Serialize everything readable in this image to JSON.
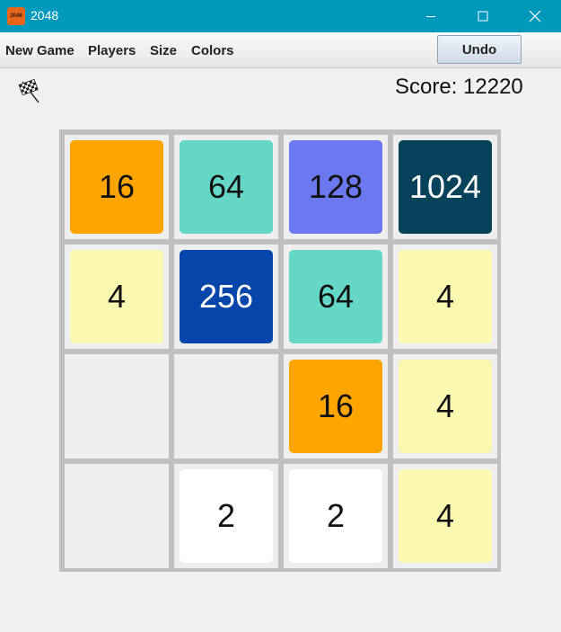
{
  "window": {
    "title": "2048",
    "icon_label": "2048",
    "controls": [
      "minimize-icon",
      "maximize-icon",
      "close-icon"
    ]
  },
  "menu": {
    "new_game": "New Game",
    "players": "Players",
    "size": "Size",
    "colors": "Colors",
    "undo": "Undo"
  },
  "status": {
    "icon": "checkered-flag-icon",
    "score_text": "Score: 12220",
    "score": 12220
  },
  "board": {
    "size": 4,
    "rows": [
      [
        "16",
        "64",
        "128",
        "1024"
      ],
      [
        "4",
        "256",
        "64",
        "4"
      ],
      [
        "",
        "",
        "16",
        "4"
      ],
      [
        "",
        "2",
        "2",
        "4"
      ]
    ]
  },
  "tile_colors": {
    "2": {
      "bg": "#ffffff",
      "fg": "#111111"
    },
    "4": {
      "bg": "#fbf8b2",
      "fg": "#111111"
    },
    "16": {
      "bg": "#ffa500",
      "fg": "#111111"
    },
    "64": {
      "bg": "#64d7c6",
      "fg": "#111111"
    },
    "128": {
      "bg": "#6b78f0",
      "fg": "#111111"
    },
    "256": {
      "bg": "#0645a9",
      "fg": "#ffffff"
    },
    "1024": {
      "bg": "#06425a",
      "fg": "#ffffff"
    }
  },
  "colors": {
    "titlebar": "#0099bc",
    "board_border": "#c0c0c0",
    "empty_cell": "#eeeeee"
  }
}
